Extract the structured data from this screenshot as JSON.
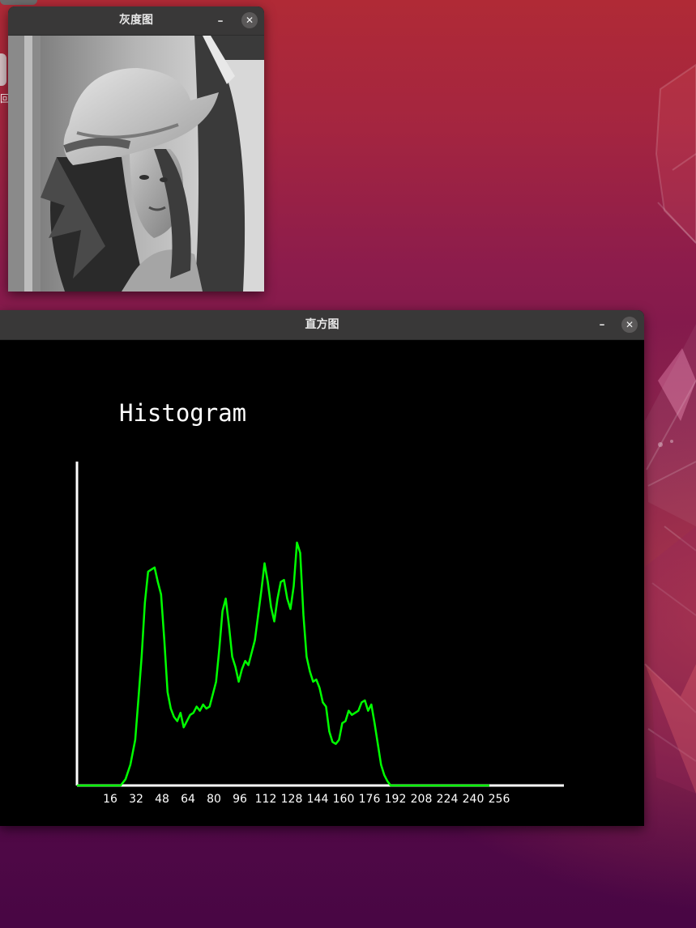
{
  "desktop": {
    "label": "回",
    "colors": {
      "top": "#b02a36",
      "bottom": "#480644",
      "accent": "#ee5c4c"
    }
  },
  "gray_window": {
    "title": "灰度图",
    "minimize_label": "–",
    "close_label": "✕",
    "image_description_icon": "grayscale-portrait-image"
  },
  "hist_window": {
    "title": "直方图",
    "minimize_label": "–",
    "close_label": "✕"
  },
  "chart_data": {
    "type": "line",
    "title": "Histogram",
    "xlabel": "",
    "ylabel": "",
    "xlim": [
      0,
      256
    ],
    "tick_labels": [
      "16",
      "32",
      "48",
      "64",
      "80",
      "96",
      "112",
      "128",
      "144",
      "160",
      "176",
      "192",
      "208",
      "224",
      "240",
      "256"
    ],
    "tick_values": [
      16,
      32,
      48,
      64,
      80,
      96,
      112,
      128,
      144,
      160,
      176,
      192,
      208,
      224,
      240,
      256
    ],
    "grid": false,
    "line_color": "#00ff00",
    "axis_color": "#ffffff",
    "series": [
      {
        "x": [
          0,
          10,
          20,
          27,
          30,
          33,
          36,
          38,
          40,
          42,
          44,
          46,
          48,
          50,
          52,
          54,
          56,
          58,
          60,
          62,
          64,
          66,
          68,
          70,
          72,
          74,
          76,
          78,
          80,
          82,
          84,
          86,
          88,
          90,
          92,
          94,
          96,
          98,
          100,
          102,
          104,
          106,
          108,
          110,
          112,
          114,
          116,
          118,
          120,
          122,
          124,
          126,
          128,
          130,
          132,
          134,
          136,
          138,
          140,
          142,
          144,
          146,
          148,
          150,
          152,
          154,
          156,
          158,
          160,
          162,
          164,
          166,
          168,
          170,
          172,
          174,
          176,
          178,
          180,
          182,
          184,
          186,
          188,
          190,
          192,
          194,
          196,
          198,
          200,
          202,
          204,
          206,
          208,
          210,
          212,
          214,
          216,
          218,
          220,
          222,
          224,
          228,
          234,
          240,
          248,
          255
        ],
        "y": [
          0,
          0,
          0,
          0,
          3,
          10,
          22,
          42,
          62,
          88,
          103,
          104,
          105,
          98,
          92,
          70,
          45,
          37,
          33,
          31,
          35,
          28,
          31,
          34,
          35,
          38,
          36,
          39,
          37,
          38,
          44,
          50,
          66,
          84,
          90,
          77,
          62,
          57,
          50,
          56,
          60,
          58,
          64,
          70,
          82,
          94,
          107,
          98,
          86,
          79,
          90,
          98,
          99,
          90,
          85,
          96,
          117,
          112,
          82,
          62,
          55,
          50,
          51,
          47,
          40,
          38,
          26,
          21,
          20,
          22,
          30,
          31,
          36,
          34,
          35,
          36,
          40,
          41,
          36,
          39,
          30,
          20,
          10,
          5,
          2,
          0,
          0,
          0,
          0,
          0,
          0,
          0,
          0,
          0,
          0,
          0,
          0,
          0,
          0,
          0,
          0,
          0,
          0,
          0,
          0,
          0
        ]
      }
    ]
  }
}
